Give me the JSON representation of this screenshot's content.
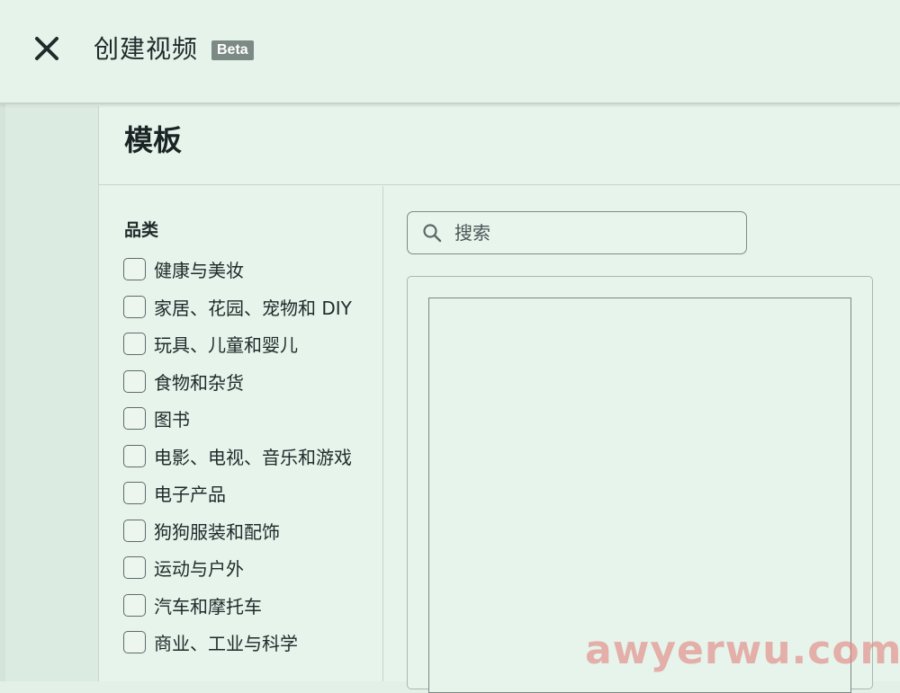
{
  "header": {
    "close_icon": "close-icon",
    "title": "创建视频",
    "badge": "Beta"
  },
  "panel": {
    "title": "模板"
  },
  "filters": {
    "title": "品类",
    "items": [
      {
        "label": "健康与美妆",
        "checked": false
      },
      {
        "label": "家居、花园、宠物和 DIY",
        "checked": false
      },
      {
        "label": "玩具、儿童和婴儿",
        "checked": false
      },
      {
        "label": "食物和杂货",
        "checked": false
      },
      {
        "label": "图书",
        "checked": false
      },
      {
        "label": "电影、电视、音乐和游戏",
        "checked": false
      },
      {
        "label": "电子产品",
        "checked": false
      },
      {
        "label": "狗狗服装和配饰",
        "checked": false
      },
      {
        "label": "运动与户外",
        "checked": false
      },
      {
        "label": "汽车和摩托车",
        "checked": false
      },
      {
        "label": "商业、工业与科学",
        "checked": false
      }
    ]
  },
  "search": {
    "placeholder": "搜索",
    "value": "",
    "icon": "search-icon"
  },
  "watermark": "awyerwu.com",
  "colors": {
    "background": "#e6f4eb",
    "badge": "#7c8a86",
    "border": "#7a8a86",
    "watermark": "#e38a86"
  }
}
